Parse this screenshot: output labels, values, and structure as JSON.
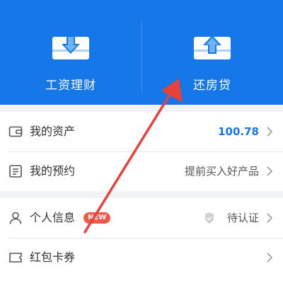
{
  "banner": {
    "left_label": "工资理财",
    "right_label": "还房贷",
    "left_icon": "download-card-icon",
    "right_icon": "upload-card-icon"
  },
  "menu": {
    "assets": {
      "label": "我的资产",
      "value": "100.78",
      "icon": "wallet-icon"
    },
    "booking": {
      "label": "我的预约",
      "value": "提前买入好产品",
      "icon": "calendar-list-icon"
    },
    "profile": {
      "label": "个人信息",
      "badge": "NEW",
      "status": "待认证",
      "icon": "user-icon"
    },
    "coupons": {
      "label": "红包卡券",
      "icon": "coupon-icon"
    }
  },
  "colors": {
    "brand_blue": "#1677e8",
    "badge_red": "#f0584a",
    "arrow_red": "#e8413a"
  }
}
